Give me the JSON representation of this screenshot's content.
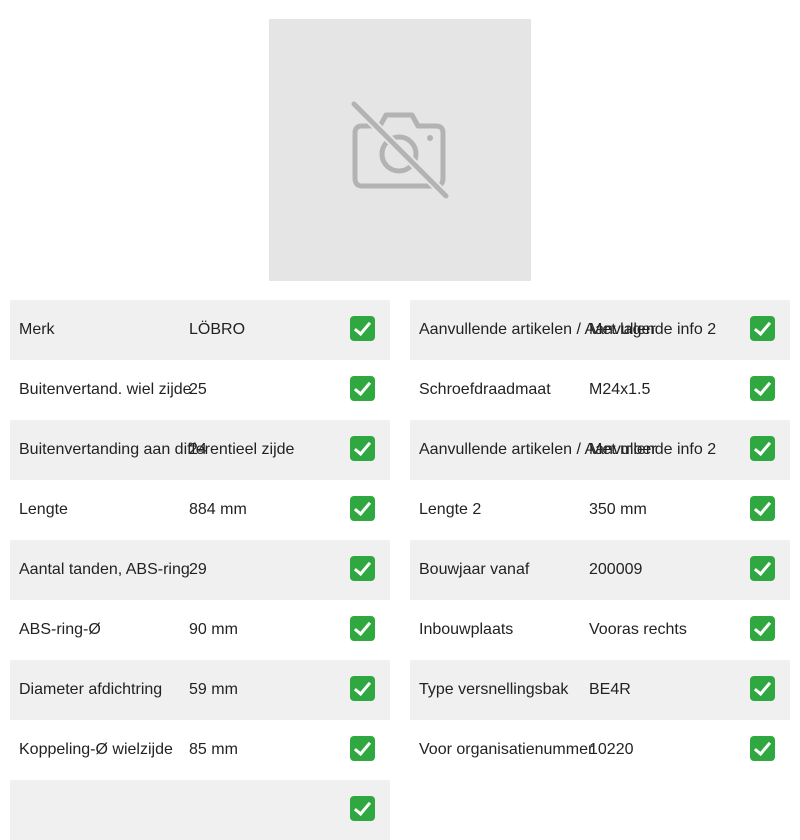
{
  "photo": {
    "icon": "camera-off-icon",
    "colors": {
      "background": "#e5e5e5",
      "icon": "#b3b3b3"
    }
  },
  "check_icon": "check-mark-icon",
  "colors": {
    "row_shade": "#f0f0f0",
    "check": "#2fa841"
  },
  "left_rows": [
    {
      "label": "Merk",
      "value": "LÖBRO"
    },
    {
      "label": "Buitenvertand. wiel zijde",
      "value": "25"
    },
    {
      "label": "Buitenvertanding aan differentieel zijde",
      "value": "24"
    },
    {
      "label": "Lengte",
      "value": "884 mm"
    },
    {
      "label": "Aantal tanden, ABS-ring",
      "value": "29"
    },
    {
      "label": "ABS-ring-Ø",
      "value": "90 mm"
    },
    {
      "label": "Diameter afdichtring",
      "value": "59 mm"
    },
    {
      "label": "Koppeling-Ø wielzijde",
      "value": "85 mm"
    }
  ],
  "right_rows": [
    {
      "label": "Aanvullende artikelen / Aanvullende info 2",
      "value": "Met lager"
    },
    {
      "label": "Schroefdraadmaat",
      "value": "M24x1.5"
    },
    {
      "label": "Aanvullende artikelen / Aanvullende info 2",
      "value": "Met moer"
    },
    {
      "label": "Lengte 2",
      "value": "350 mm"
    },
    {
      "label": "Bouwjaar vanaf",
      "value": "200009"
    },
    {
      "label": "Inbouwplaats",
      "value": "Vooras rechts"
    },
    {
      "label": "Type versnellingsbak",
      "value": "BE4R"
    },
    {
      "label": "Voor organisatienummer",
      "value": "10220"
    }
  ]
}
